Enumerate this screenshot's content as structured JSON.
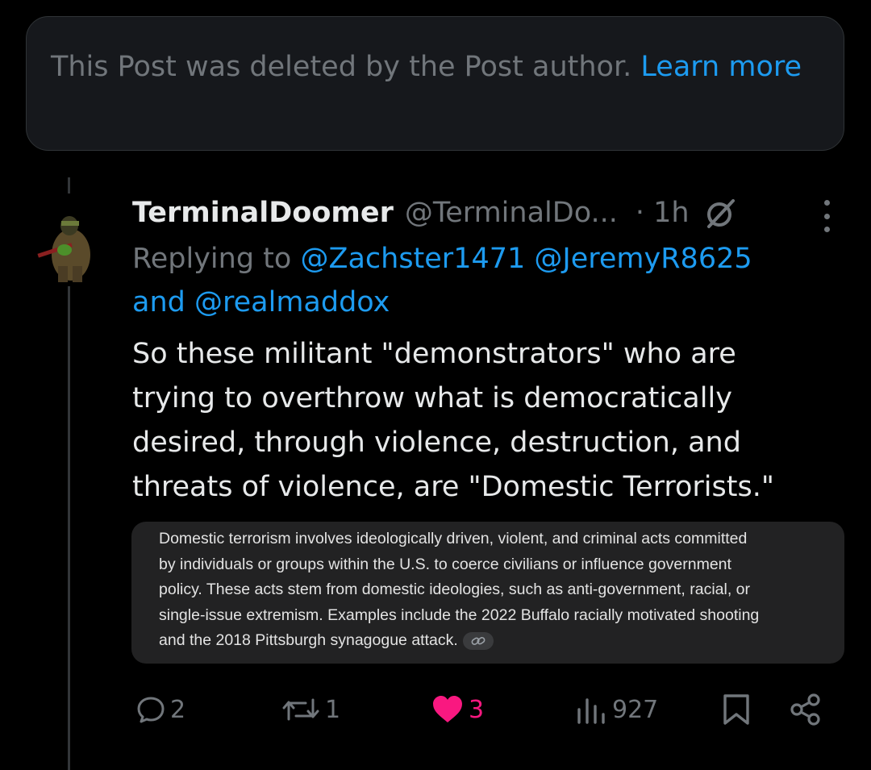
{
  "deleted_notice": {
    "text": "This Post was deleted by the Post author.",
    "link": "Learn more"
  },
  "tweet": {
    "display_name": "TerminalDoomer",
    "handle": "@TerminalDo...",
    "time": "· 1h",
    "replying_to_label": "Replying to",
    "mention_1": "@Zachster1471",
    "mention_2": "@JeremyR8625",
    "and_label": "and",
    "mention_3": "@realmaddox",
    "text_lines": [
      "So these militant \"demonstrators\" who are",
      "trying to overthrow what is democratically",
      "desired, through violence, destruction, and",
      "threats of violence, are \"Domestic Terrorists.\""
    ],
    "quote_lines": [
      "Domestic terrorism involves ideologically driven, violent, and criminal acts committed",
      "by individuals or groups within the U.S. to coerce civilians or influence government",
      "policy. These acts stem from domestic ideologies, such as anti-government, racial, or",
      "single-issue extremism. Examples include the 2022 Buffalo racially motivated shooting",
      "and the 2018 Pittsburgh synagogue attack."
    ]
  },
  "actions": {
    "replies": "2",
    "reposts": "1",
    "likes": "3",
    "views": "927"
  },
  "colors": {
    "background": "#000000",
    "link": "#1d9bf0",
    "muted": "#71767b",
    "like": "#f91880"
  },
  "icons": {
    "reply": "reply-icon",
    "repost": "repost-icon",
    "like": "heart-icon",
    "views": "views-icon",
    "bookmark": "bookmark-icon",
    "share": "share-icon",
    "more": "more-icon",
    "grok": "slashed-circle-icon",
    "link": "link-icon"
  }
}
